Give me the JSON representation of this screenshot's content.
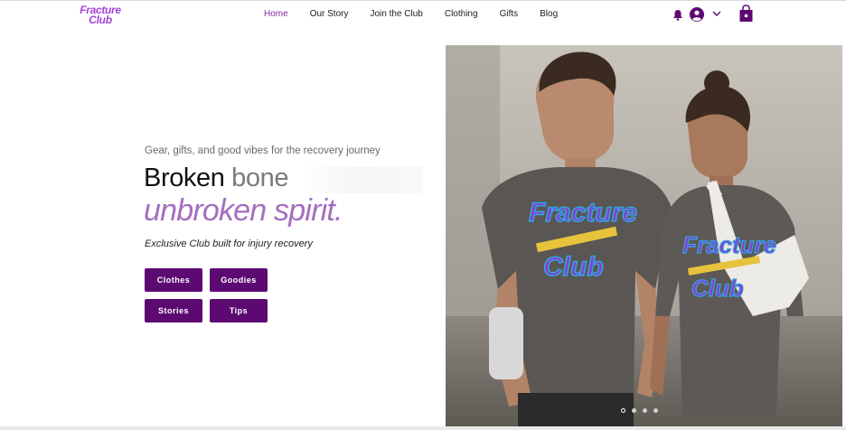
{
  "header": {
    "logo_line1": "Fracture",
    "logo_line2": "Club",
    "nav": [
      {
        "label": "Home",
        "active": true
      },
      {
        "label": "Our Story"
      },
      {
        "label": "Join the Club"
      },
      {
        "label": "Clothing"
      },
      {
        "label": "Gifts"
      },
      {
        "label": "Blog"
      }
    ],
    "icons": [
      "bell-icon",
      "account-icon",
      "chevron-down-icon",
      "shopping-bag-icon"
    ],
    "accent_color": "#7c2d9f"
  },
  "hero": {
    "tagline": "Gear, gifts, and good vibes for the recovery journey",
    "headline_word1": "Broken",
    "headline_word2": "bone",
    "headline_line2": "unbroken spirit.",
    "subline": "Exclusive Club built for injury recovery",
    "buttons": [
      "Clothes",
      "Goodies",
      "Stories",
      "Tips"
    ],
    "button_color": "#5c0a72",
    "image_shirt_text_1": "Fracture",
    "image_shirt_text_2": "Club",
    "carousel_dots": 4,
    "carousel_active": 1
  }
}
